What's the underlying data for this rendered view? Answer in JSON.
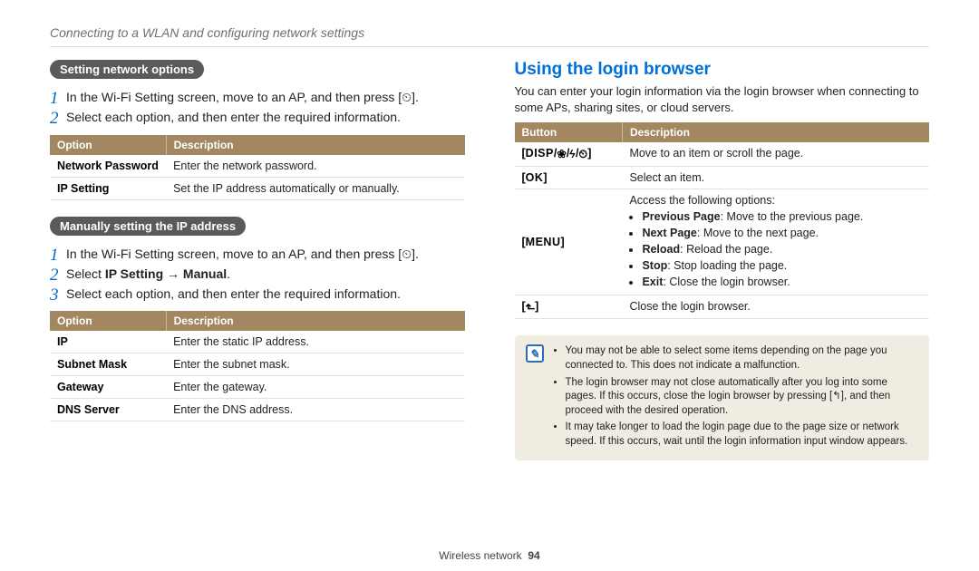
{
  "breadcrumb": "Connecting to a WLAN and configuring network settings",
  "left": {
    "section1": {
      "pill": "Setting network options",
      "steps": [
        "In the Wi-Fi Setting screen, move to an AP, and then press [⏲].",
        "Select each option, and then enter the required information."
      ],
      "table": {
        "h1": "Option",
        "h2": "Description",
        "rows": [
          {
            "k": "Network Password",
            "v": "Enter the network password."
          },
          {
            "k": "IP Setting",
            "v": "Set the IP address automatically or manually."
          }
        ]
      }
    },
    "section2": {
      "pill": "Manually setting the IP address",
      "steps": [
        {
          "text": "In the Wi-Fi Setting screen, move to an AP, and then press [⏲]."
        },
        {
          "prefix": "Select ",
          "bold1": "IP Setting",
          "arrow": " → ",
          "bold2": "Manual",
          "suffix": "."
        },
        {
          "text": "Select each option, and then enter the required information."
        }
      ],
      "table": {
        "h1": "Option",
        "h2": "Description",
        "rows": [
          {
            "k": "IP",
            "v": "Enter the static IP address."
          },
          {
            "k": "Subnet Mask",
            "v": "Enter the subnet mask."
          },
          {
            "k": "Gateway",
            "v": "Enter the gateway."
          },
          {
            "k": "DNS Server",
            "v": "Enter the DNS address."
          }
        ]
      }
    }
  },
  "right": {
    "heading": "Using the login browser",
    "intro": "You can enter your login information via the login browser when connecting to some APs, sharing sites, or cloud servers.",
    "table": {
      "h1": "Button",
      "h2": "Description",
      "rows": [
        {
          "btn_type": "disp",
          "label": "DISP",
          "desc": "Move to an item or scroll the page."
        },
        {
          "btn_type": "ok",
          "label": "OK",
          "desc": "Select an item."
        },
        {
          "btn_type": "menu",
          "label": "MENU",
          "descHead": "Access the following options:",
          "opts": [
            {
              "b": "Previous Page",
              "t": ": Move to the previous page."
            },
            {
              "b": "Next Page",
              "t": ": Move to the next page."
            },
            {
              "b": "Reload",
              "t": ": Reload the page."
            },
            {
              "b": "Stop",
              "t": ": Stop loading the page."
            },
            {
              "b": "Exit",
              "t": ": Close the login browser."
            }
          ]
        },
        {
          "btn_type": "back",
          "desc": "Close the login browser."
        }
      ]
    },
    "notes": [
      "You may not be able to select some items depending on the page you connected to. This does not indicate a malfunction.",
      "The login browser may not close automatically after you log into some pages. If this occurs, close the login browser by pressing [↰], and then proceed with the desired operation.",
      "It may take longer to load the login page due to the page size or network speed. If this occurs, wait until the login information input window appears."
    ]
  },
  "footer": {
    "label": "Wireless network",
    "page": "94"
  }
}
